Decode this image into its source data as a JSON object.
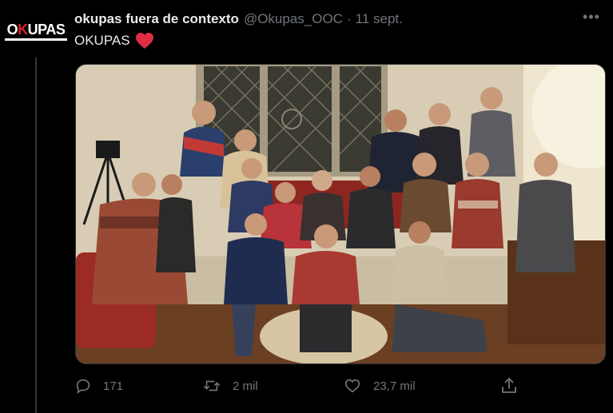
{
  "tweet": {
    "account_name": "okupas fuera de contexto",
    "handle": "@Okupas_OOC",
    "separator": "·",
    "date": "11 sept.",
    "text": "OKUPAS",
    "emoji": "red-heart",
    "more_label": "•••"
  },
  "avatar": {
    "logo_letters_white_1": "O",
    "logo_letters_red": "K",
    "logo_letters_white_2": "UPAS"
  },
  "media": {
    "description_icon": "group-photo",
    "colors": {
      "wall": "#d8cdb4",
      "window": "#3a3a32",
      "floor": "#6a3f22",
      "sofa": "#9c2b24"
    }
  },
  "actions": {
    "reply": {
      "icon": "reply-icon",
      "count": "171"
    },
    "retweet": {
      "icon": "retweet-icon",
      "count": "2 mil"
    },
    "like": {
      "icon": "like-icon",
      "count": "23,7 mil"
    },
    "share": {
      "icon": "share-icon"
    }
  },
  "colors": {
    "background": "#000000",
    "text": "#e7e9ea",
    "secondary": "#71767b",
    "heart": "#f91880"
  }
}
